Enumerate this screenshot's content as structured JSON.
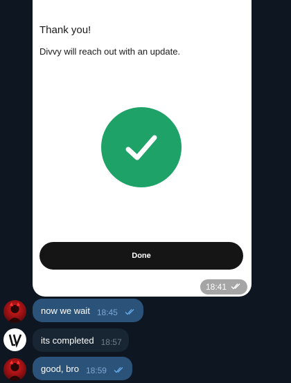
{
  "card": {
    "title": "Thank you!",
    "subtitle": "Divvy will reach out with an update.",
    "done_label": "Done",
    "time": "18:41",
    "accent_green": "#1ea267"
  },
  "messages": [
    {
      "text": "now we wait",
      "time": "18:45",
      "direction": "out",
      "read": true
    },
    {
      "text": "its completed",
      "time": "18:57",
      "direction": "in",
      "read": false
    },
    {
      "text": "good, bro",
      "time": "18:59",
      "direction": "out",
      "read": true
    }
  ],
  "colors": {
    "background": "#0e1621",
    "outgoing_bubble": "#2b5278",
    "incoming_bubble": "#182533"
  }
}
